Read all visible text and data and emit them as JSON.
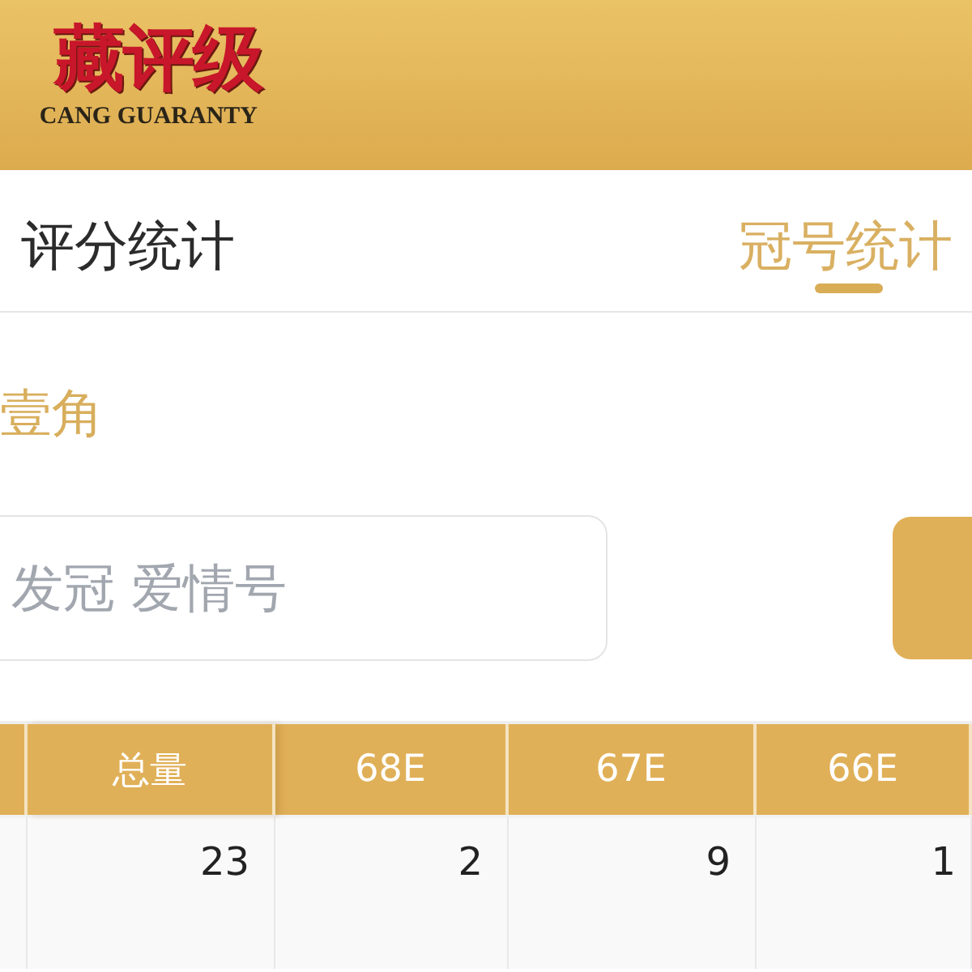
{
  "header": {
    "logo_cn": "藏评级",
    "logo_en": "CANG GUARANTY"
  },
  "tabs": [
    {
      "label": "评分统计",
      "selected": false
    },
    {
      "label": "冠号统计",
      "selected": true
    }
  ],
  "section_title": "壹角",
  "search": {
    "placeholder": "发冠 爱情号"
  },
  "table": {
    "columns": [
      "总量",
      "68E",
      "67E",
      "66E"
    ],
    "rows": [
      [
        "23",
        "2",
        "9",
        "1"
      ]
    ]
  }
}
